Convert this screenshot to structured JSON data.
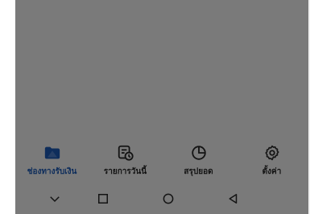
{
  "colors": {
    "active": "#1f5fbf",
    "inactive": "#2a2a2a",
    "overlay": "rgba(0,0,0,0.52)"
  },
  "bottom_nav": {
    "items": [
      {
        "label": "ช่องทางรับเงิน",
        "icon": "folder-icon",
        "active": true
      },
      {
        "label": "รายการวันนี้",
        "icon": "receipt-clock-icon",
        "active": false
      },
      {
        "label": "สรุปยอด",
        "icon": "pie-chart-icon",
        "active": false
      },
      {
        "label": "ตั้งค่า",
        "icon": "gear-icon",
        "active": false
      }
    ]
  },
  "system_nav": {
    "items": [
      "chevron-down-icon",
      "recents-square-icon",
      "home-circle-icon",
      "back-triangle-icon"
    ]
  }
}
